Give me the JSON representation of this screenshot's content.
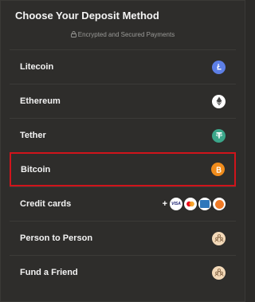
{
  "header": {
    "title": "Choose Your Deposit Method",
    "subtitle": "Encrypted and Secured Payments"
  },
  "methods": [
    {
      "label": "Litecoin",
      "icon": "litecoin-icon",
      "color": "#5d7fe6"
    },
    {
      "label": "Ethereum",
      "icon": "ethereum-icon",
      "color": "#ffffff"
    },
    {
      "label": "Tether",
      "icon": "tether-icon",
      "color": "#3ba68a"
    },
    {
      "label": "Bitcoin",
      "icon": "bitcoin-icon",
      "color": "#f08c1c",
      "selected": true
    },
    {
      "label": "Credit cards",
      "icon": "credit-card-icons",
      "plus": "+",
      "visa": "VISA"
    },
    {
      "label": "Person to Person",
      "icon": "people-icon",
      "color": "#f3d9b8"
    },
    {
      "label": "Fund a Friend",
      "icon": "people-icon",
      "color": "#f3d9b8"
    }
  ],
  "colors": {
    "background": "#2e2d2b",
    "highlight_border": "#d0141b"
  }
}
